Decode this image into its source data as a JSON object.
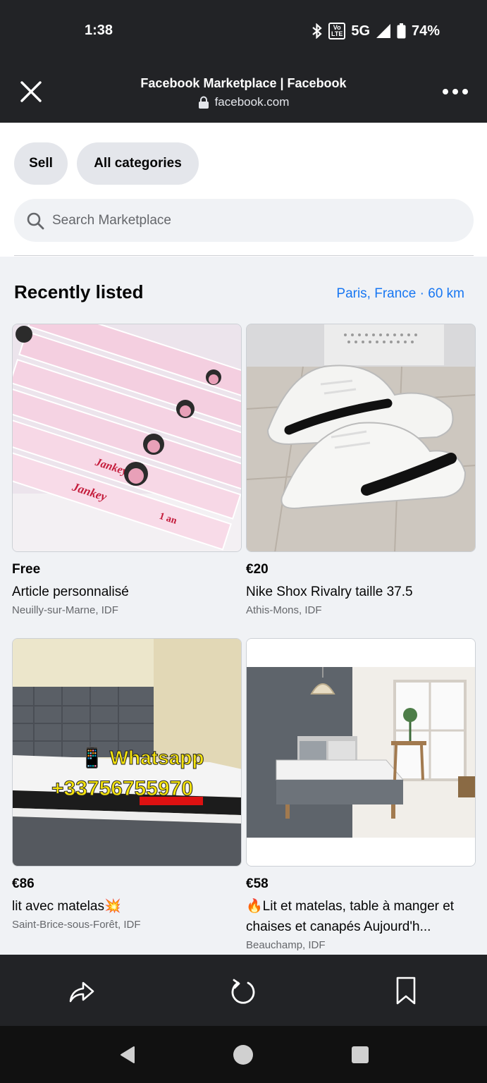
{
  "status": {
    "time": "1:38",
    "volte": "Vo LTE",
    "network": "5G",
    "battery": "74%"
  },
  "browser": {
    "title": "Facebook Marketplace | Facebook",
    "url": "facebook.com"
  },
  "chips": {
    "sell": "Sell",
    "categories": "All categories"
  },
  "search": {
    "placeholder": "Search Marketplace"
  },
  "section": {
    "title": "Recently listed",
    "location": "Paris, France · 60 km"
  },
  "listings": [
    {
      "price": "Free",
      "title": "Article personnalisé",
      "location": "Neuilly-sur-Marne, IDF",
      "image_text": [
        "Jankey",
        "1 an"
      ]
    },
    {
      "price": "€20",
      "title": "Nike Shox Rivalry taille 37.5",
      "location": "Athis-Mons, IDF"
    },
    {
      "price": "€86",
      "title": "lit avec matelas💥",
      "location": "Saint-Brice-sous-Forêt, IDF",
      "image_text": [
        "📱 Whatsapp",
        "+33756755970"
      ]
    },
    {
      "price": "€58",
      "title": "🔥Lit et matelas, table à manger et chaises et canapés Aujourd'h...",
      "location": "Beauchamp, IDF"
    }
  ],
  "icons": {
    "close": "close-icon",
    "more": "more-icon",
    "lock": "lock-icon",
    "search": "search-icon",
    "share": "share-icon",
    "reload": "reload-icon",
    "bookmark": "bookmark-icon"
  },
  "colors": {
    "accent": "#1877f2",
    "chrome": "#222326",
    "background": "#f0f2f5"
  }
}
